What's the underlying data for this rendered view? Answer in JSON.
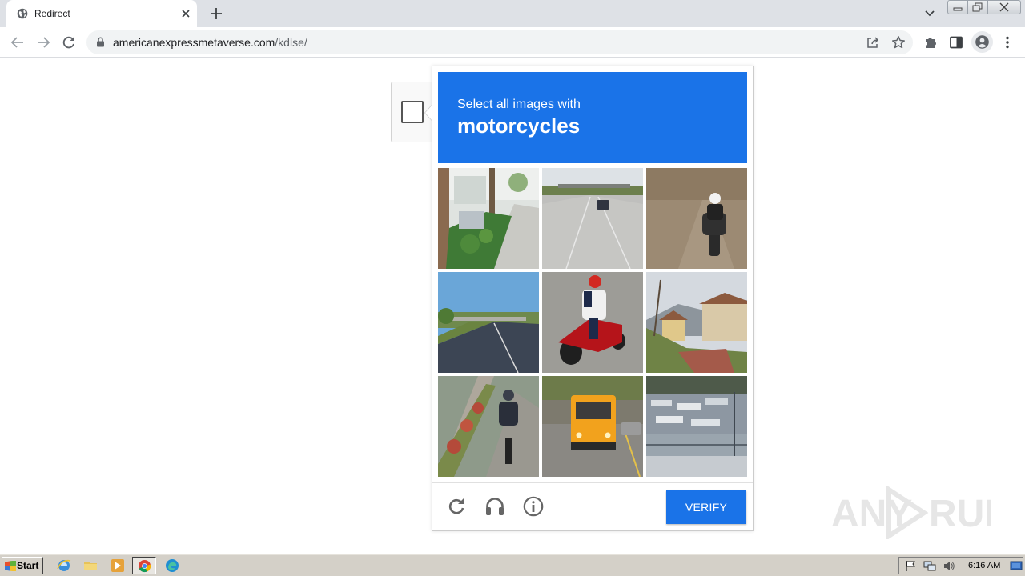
{
  "browser": {
    "tab_title": "Redirect",
    "url_host": "americanexpressmetaverse.com",
    "url_path": "/kdlse/"
  },
  "captcha": {
    "prompt_line1": "Select all images with",
    "prompt_target": "motorcycles",
    "verify_label": "VERIFY",
    "accent_color": "#1a73e8",
    "tiles": [
      {
        "index": 1,
        "depicts": "street with palm trees and hedge"
      },
      {
        "index": 2,
        "depicts": "highway with car and overpass"
      },
      {
        "index": 3,
        "depicts": "motorcycle rider on road"
      },
      {
        "index": 4,
        "depicts": "highway with trees"
      },
      {
        "index": 5,
        "depicts": "red motorcycle rider"
      },
      {
        "index": 6,
        "depicts": "houses on hillside"
      },
      {
        "index": 7,
        "depicts": "motorcycle rider on path"
      },
      {
        "index": 8,
        "depicts": "yellow school bus"
      },
      {
        "index": 9,
        "depicts": "boats in marina"
      }
    ]
  },
  "watermark": {
    "text": "ANY RUN"
  },
  "taskbar": {
    "start_label": "Start",
    "clock": "6:16 AM"
  }
}
